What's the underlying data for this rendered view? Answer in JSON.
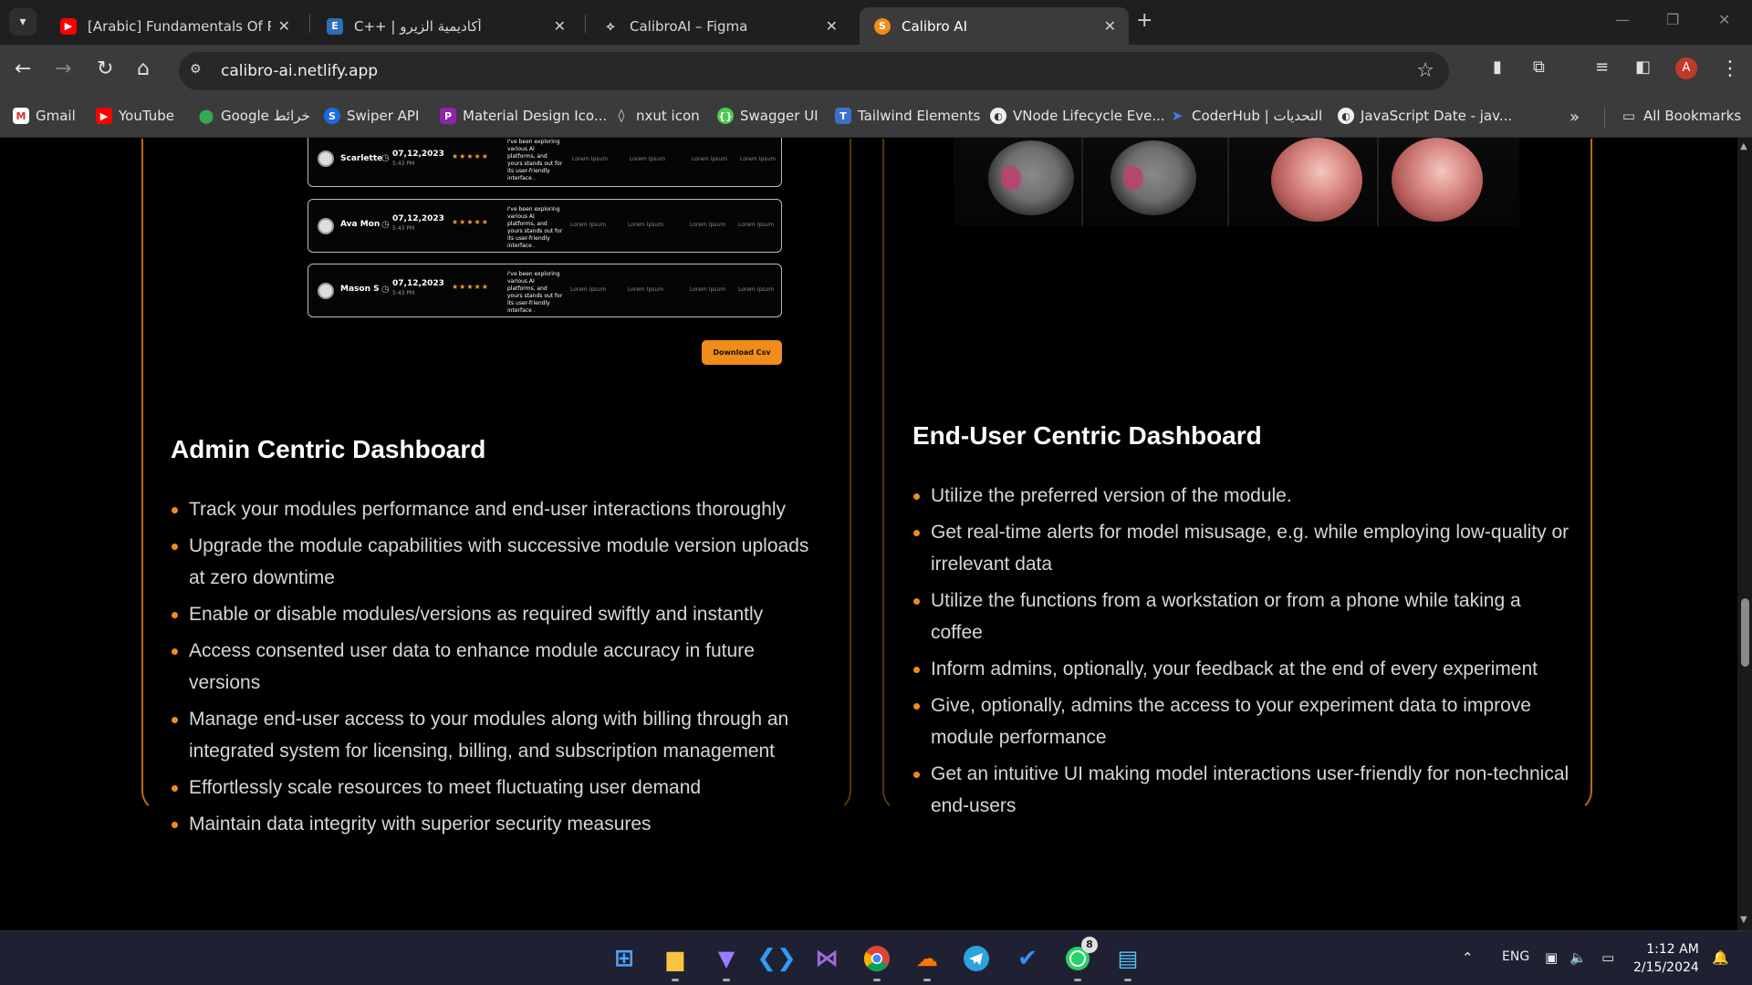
{
  "browser": {
    "tabs": [
      {
        "title": "[Arabic] Fundamentals Of Progr",
        "favicon": "youtube-favicon",
        "active": false
      },
      {
        "title": "C++ | أكاديمية الزيرو",
        "favicon": "e-favicon",
        "active": false
      },
      {
        "title": "CalibroAI – Figma",
        "favicon": "figma-favicon",
        "active": false
      },
      {
        "title": "Calibro AI",
        "favicon": "calibro-favicon",
        "active": true
      }
    ],
    "url": "calibro-ai.netlify.app",
    "profile_initial": "A",
    "bookmarks": [
      {
        "label": "Gmail",
        "icon": "gmail-icon"
      },
      {
        "label": "YouTube",
        "icon": "youtube-icon"
      },
      {
        "label": "Google خرائط",
        "icon": "maps-icon"
      },
      {
        "label": "Swiper API",
        "icon": "swiper-icon"
      },
      {
        "label": "Material Design Ico...",
        "icon": "material-icon"
      },
      {
        "label": "nxut icon",
        "icon": "nxut-icon"
      },
      {
        "label": "Swagger UI",
        "icon": "swagger-icon"
      },
      {
        "label": "Tailwind Elements",
        "icon": "tailwind-icon"
      },
      {
        "label": "VNode Lifecycle Eve...",
        "icon": "globe-icon"
      },
      {
        "label": "CoderHub | التحديات",
        "icon": "coderhub-icon"
      },
      {
        "label": "JavaScript Date - jav...",
        "icon": "globe-icon"
      }
    ],
    "all_bookmarks_label": "All Bookmarks"
  },
  "admin_preview": {
    "rows": [
      {
        "name": "Scarlette",
        "date": "07,12,2023",
        "time": "5:43 PM",
        "stars": "★★★★★",
        "review": "I've been exploring various AI platforms, and yours stands out for its user-friendly interface .",
        "cells": [
          "Lorem Ipsum",
          "Lorem Ipsum",
          "Lorem Ipsum",
          "Lorem Ipsum"
        ]
      },
      {
        "name": "Ava Mon",
        "date": "07,12,2023",
        "time": "5:43 PM",
        "stars": "★★★★★",
        "review": "I've been exploring various AI platforms, and yours stands out for its user-friendly interface .",
        "cells": [
          "Lorem Ipsum",
          "Lorem Ipsum",
          "Lorem Ipsum",
          "Lorem Ipsum"
        ]
      },
      {
        "name": "Mason S",
        "date": "07,12,2023",
        "time": "5:43 PM",
        "stars": "★★★★★",
        "review": "I've been exploring various AI platforms, and yours stands out for its user-friendly interface .",
        "cells": [
          "Lorem Ipsum",
          "Lorem Ipsum",
          "Lorem Ipsum",
          "Lorem Ipsum"
        ]
      }
    ],
    "download_label": "Download Csv"
  },
  "admin": {
    "title": "Admin Centric Dashboard",
    "bullets": [
      "Track your modules performance and end-user interactions thoroughly",
      "Upgrade the module capabilities with successive module version uploads at zero downtime",
      "Enable or disable modules/versions as required swiftly and instantly",
      "Access consented user data to enhance module accuracy in future versions",
      "Manage end-user access to your modules along with billing through an integrated system for licensing, billing, and subscription management",
      "Effortlessly scale resources to meet fluctuating user demand",
      "Maintain data integrity with superior security measures"
    ]
  },
  "enduser": {
    "title": "End-User Centric Dashboard",
    "bullets": [
      "Utilize the preferred version of the module.",
      "Get real-time alerts for model misusage, e.g. while employing low-quality or irrelevant data",
      "Utilize the functions from a workstation or from a phone while taking a coffee",
      "Inform admins, optionally, your feedback at the end of every experiment",
      "Give, optionally, admins the access to your experiment data to improve module performance",
      "Get an intuitive UI making model interactions user-friendly for non-technical end-users"
    ]
  },
  "taskbar": {
    "whatsapp_badge": "8",
    "lang": "ENG",
    "time": "1:12 AM",
    "date": "2/15/2024"
  },
  "colors": {
    "accent": "#ef8c1a",
    "background": "#000000"
  }
}
